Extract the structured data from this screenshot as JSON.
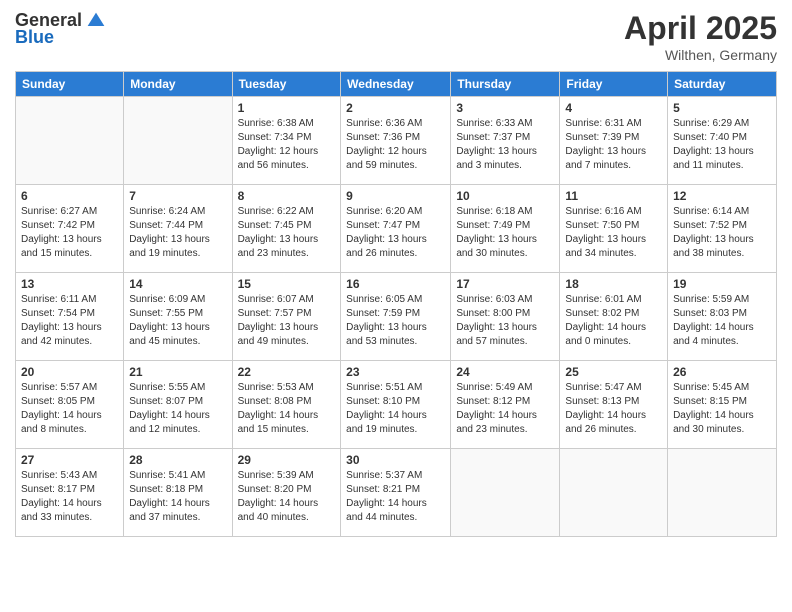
{
  "logo": {
    "general": "General",
    "blue": "Blue"
  },
  "title": {
    "month": "April 2025",
    "location": "Wilthen, Germany"
  },
  "days_of_week": [
    "Sunday",
    "Monday",
    "Tuesday",
    "Wednesday",
    "Thursday",
    "Friday",
    "Saturday"
  ],
  "weeks": [
    [
      {
        "day": "",
        "info": ""
      },
      {
        "day": "",
        "info": ""
      },
      {
        "day": "1",
        "info": "Sunrise: 6:38 AM\nSunset: 7:34 PM\nDaylight: 12 hours and 56 minutes."
      },
      {
        "day": "2",
        "info": "Sunrise: 6:36 AM\nSunset: 7:36 PM\nDaylight: 12 hours and 59 minutes."
      },
      {
        "day": "3",
        "info": "Sunrise: 6:33 AM\nSunset: 7:37 PM\nDaylight: 13 hours and 3 minutes."
      },
      {
        "day": "4",
        "info": "Sunrise: 6:31 AM\nSunset: 7:39 PM\nDaylight: 13 hours and 7 minutes."
      },
      {
        "day": "5",
        "info": "Sunrise: 6:29 AM\nSunset: 7:40 PM\nDaylight: 13 hours and 11 minutes."
      }
    ],
    [
      {
        "day": "6",
        "info": "Sunrise: 6:27 AM\nSunset: 7:42 PM\nDaylight: 13 hours and 15 minutes."
      },
      {
        "day": "7",
        "info": "Sunrise: 6:24 AM\nSunset: 7:44 PM\nDaylight: 13 hours and 19 minutes."
      },
      {
        "day": "8",
        "info": "Sunrise: 6:22 AM\nSunset: 7:45 PM\nDaylight: 13 hours and 23 minutes."
      },
      {
        "day": "9",
        "info": "Sunrise: 6:20 AM\nSunset: 7:47 PM\nDaylight: 13 hours and 26 minutes."
      },
      {
        "day": "10",
        "info": "Sunrise: 6:18 AM\nSunset: 7:49 PM\nDaylight: 13 hours and 30 minutes."
      },
      {
        "day": "11",
        "info": "Sunrise: 6:16 AM\nSunset: 7:50 PM\nDaylight: 13 hours and 34 minutes."
      },
      {
        "day": "12",
        "info": "Sunrise: 6:14 AM\nSunset: 7:52 PM\nDaylight: 13 hours and 38 minutes."
      }
    ],
    [
      {
        "day": "13",
        "info": "Sunrise: 6:11 AM\nSunset: 7:54 PM\nDaylight: 13 hours and 42 minutes."
      },
      {
        "day": "14",
        "info": "Sunrise: 6:09 AM\nSunset: 7:55 PM\nDaylight: 13 hours and 45 minutes."
      },
      {
        "day": "15",
        "info": "Sunrise: 6:07 AM\nSunset: 7:57 PM\nDaylight: 13 hours and 49 minutes."
      },
      {
        "day": "16",
        "info": "Sunrise: 6:05 AM\nSunset: 7:59 PM\nDaylight: 13 hours and 53 minutes."
      },
      {
        "day": "17",
        "info": "Sunrise: 6:03 AM\nSunset: 8:00 PM\nDaylight: 13 hours and 57 minutes."
      },
      {
        "day": "18",
        "info": "Sunrise: 6:01 AM\nSunset: 8:02 PM\nDaylight: 14 hours and 0 minutes."
      },
      {
        "day": "19",
        "info": "Sunrise: 5:59 AM\nSunset: 8:03 PM\nDaylight: 14 hours and 4 minutes."
      }
    ],
    [
      {
        "day": "20",
        "info": "Sunrise: 5:57 AM\nSunset: 8:05 PM\nDaylight: 14 hours and 8 minutes."
      },
      {
        "day": "21",
        "info": "Sunrise: 5:55 AM\nSunset: 8:07 PM\nDaylight: 14 hours and 12 minutes."
      },
      {
        "day": "22",
        "info": "Sunrise: 5:53 AM\nSunset: 8:08 PM\nDaylight: 14 hours and 15 minutes."
      },
      {
        "day": "23",
        "info": "Sunrise: 5:51 AM\nSunset: 8:10 PM\nDaylight: 14 hours and 19 minutes."
      },
      {
        "day": "24",
        "info": "Sunrise: 5:49 AM\nSunset: 8:12 PM\nDaylight: 14 hours and 23 minutes."
      },
      {
        "day": "25",
        "info": "Sunrise: 5:47 AM\nSunset: 8:13 PM\nDaylight: 14 hours and 26 minutes."
      },
      {
        "day": "26",
        "info": "Sunrise: 5:45 AM\nSunset: 8:15 PM\nDaylight: 14 hours and 30 minutes."
      }
    ],
    [
      {
        "day": "27",
        "info": "Sunrise: 5:43 AM\nSunset: 8:17 PM\nDaylight: 14 hours and 33 minutes."
      },
      {
        "day": "28",
        "info": "Sunrise: 5:41 AM\nSunset: 8:18 PM\nDaylight: 14 hours and 37 minutes."
      },
      {
        "day": "29",
        "info": "Sunrise: 5:39 AM\nSunset: 8:20 PM\nDaylight: 14 hours and 40 minutes."
      },
      {
        "day": "30",
        "info": "Sunrise: 5:37 AM\nSunset: 8:21 PM\nDaylight: 14 hours and 44 minutes."
      },
      {
        "day": "",
        "info": ""
      },
      {
        "day": "",
        "info": ""
      },
      {
        "day": "",
        "info": ""
      }
    ]
  ]
}
